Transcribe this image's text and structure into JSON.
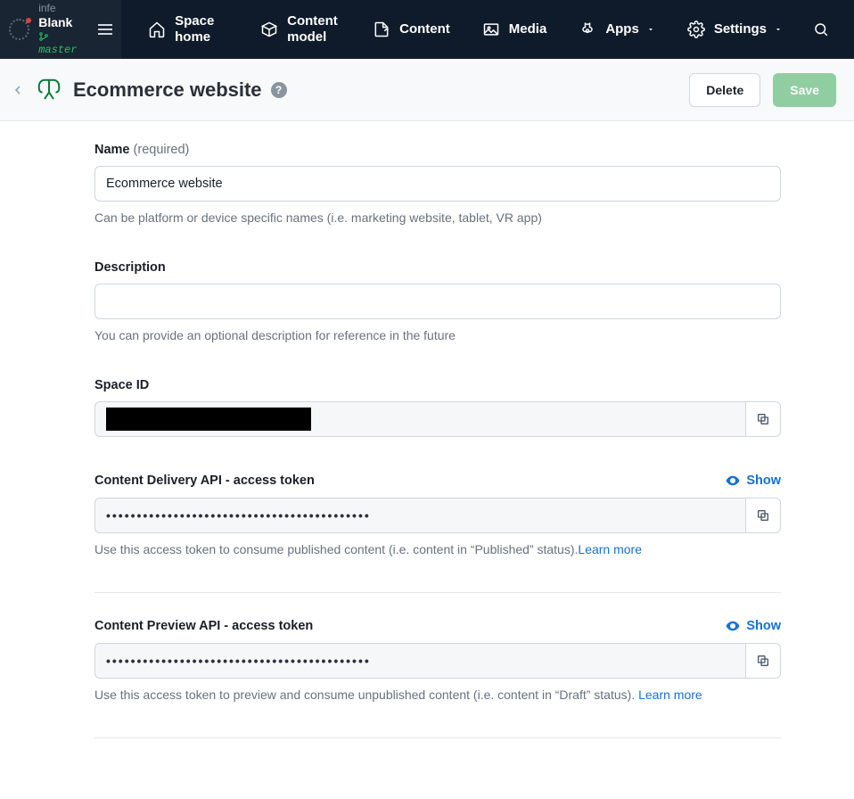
{
  "header": {
    "org_label": "infe",
    "space_label": "Blank",
    "branch_label": "master"
  },
  "nav": {
    "space_home": "Space home",
    "content_model": "Content model",
    "content": "Content",
    "media": "Media",
    "apps": "Apps",
    "settings": "Settings"
  },
  "page": {
    "title": "Ecommerce website",
    "delete_label": "Delete",
    "save_label": "Save"
  },
  "fields": {
    "name": {
      "label": "Name",
      "required_text": "(required)",
      "value": "Ecommerce website",
      "help": "Can be platform or device specific names (i.e. marketing website, tablet, VR app)"
    },
    "description": {
      "label": "Description",
      "value": "",
      "help": "You can provide an optional description for reference in the future"
    },
    "space_id": {
      "label": "Space ID"
    },
    "delivery_token": {
      "label": "Content Delivery API - access token",
      "show_label": "Show",
      "masked": "•••••••••••••••••••••••••••••••••••••••••••",
      "help": "Use this access token to consume published content (i.e. content in “Published” status).",
      "learn_more": "Learn more"
    },
    "preview_token": {
      "label": "Content Preview API - access token",
      "show_label": "Show",
      "masked": "•••••••••••••••••••••••••••••••••••••••••••",
      "help": "Use this access token to preview and consume unpublished content (i.e. content in “Draft” status). ",
      "learn_more": "Learn more"
    }
  }
}
